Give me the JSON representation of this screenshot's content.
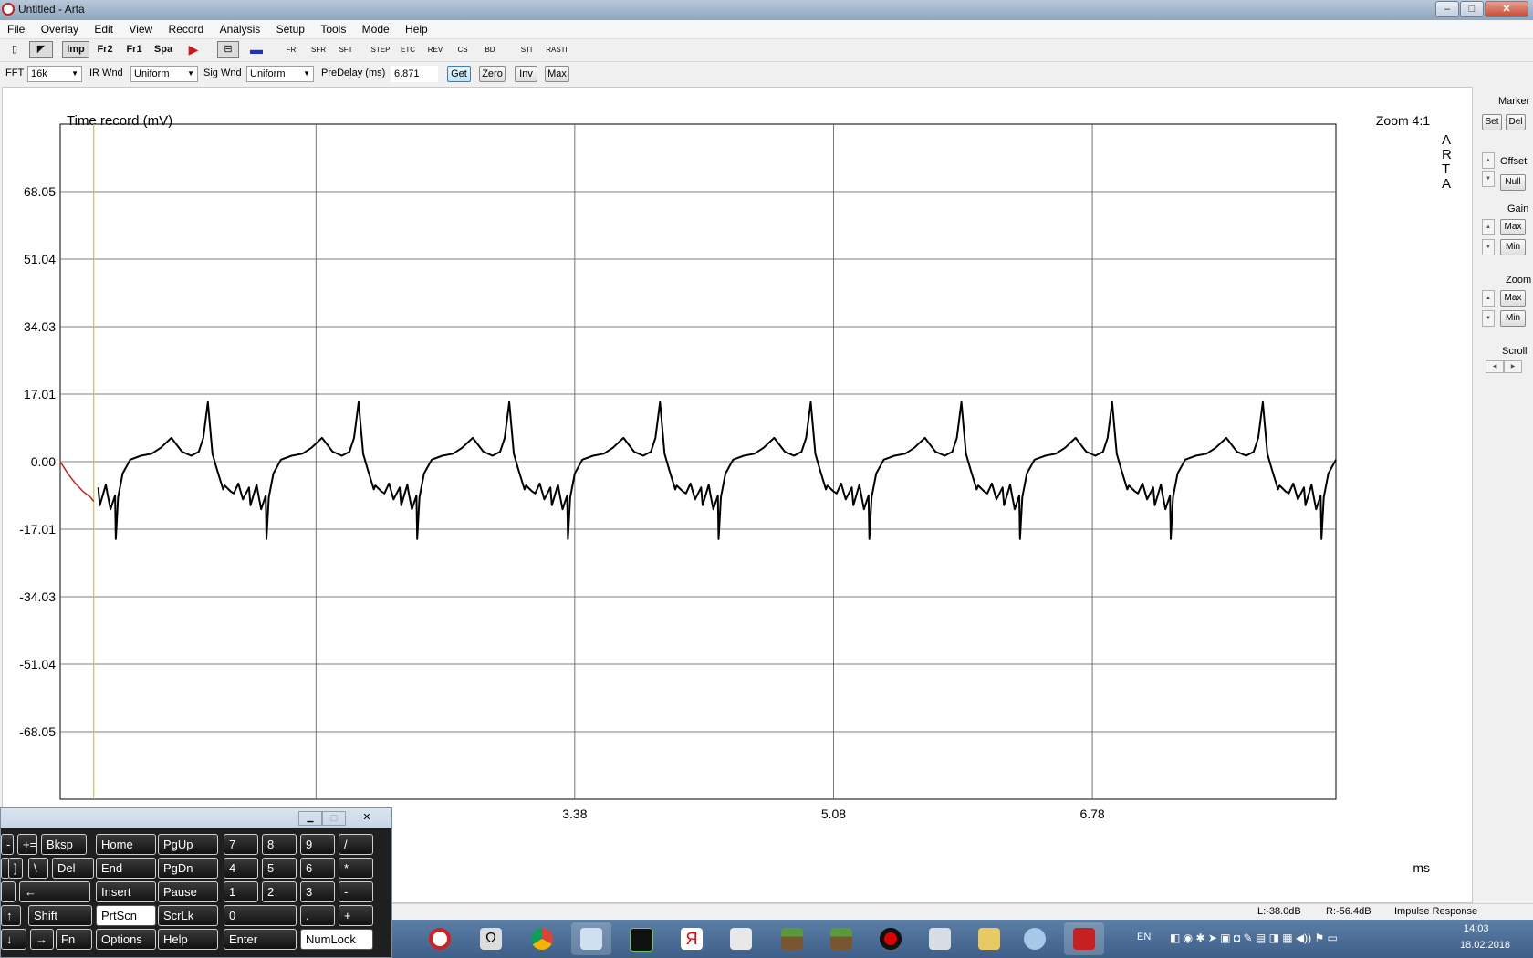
{
  "window": {
    "title": "Untitled - Arta",
    "buttons": {
      "min": "–",
      "max": "□",
      "close": "✕"
    }
  },
  "menu": [
    "File",
    "Overlay",
    "Edit",
    "View",
    "Record",
    "Analysis",
    "Setup",
    "Tools",
    "Mode",
    "Help"
  ],
  "toolbar": {
    "imp": "Imp",
    "fr2": "Fr2",
    "fr1": "Fr1",
    "spa": "Spa",
    "icons": [
      "FR",
      "SFR",
      "SFT",
      "STEP",
      "ETC",
      "REV",
      "CS",
      "BD",
      "STI",
      "RASTI"
    ]
  },
  "params": {
    "fft_label": "FFT",
    "fft_value": "16k",
    "ir_wnd_label": "IR Wnd",
    "ir_wnd_value": "Uniform",
    "sig_wnd_label": "Sig Wnd",
    "sig_wnd_value": "Uniform",
    "predelay_label": "PreDelay (ms)",
    "predelay_value": "6.871",
    "get": "Get",
    "zero": "Zero",
    "inv": "Inv",
    "max": "Max"
  },
  "side_panel": {
    "marker": "Marker",
    "set": "Set",
    "del": "Del",
    "offset": "Offset",
    "null": "Null",
    "gain": "Gain",
    "gain_max": "Max",
    "gain_min": "Min",
    "zoom": "Zoom",
    "zoom_max": "Max",
    "zoom_min": "Min",
    "scroll": "Scroll"
  },
  "chart_data": {
    "type": "line",
    "title": "Time record (mV)",
    "zoom_label": "Zoom 4:1",
    "watermark": [
      "A",
      "R",
      "T",
      "A"
    ],
    "xlabel": "ms",
    "xlim": [
      0.0,
      8.38
    ],
    "ylim": [
      -85.06,
      85.06
    ],
    "y_ticks": [
      "68.05",
      "51.04",
      "34.03",
      "17.01",
      "0.00",
      "-17.01",
      "-34.03",
      "-51.04",
      "-68.05"
    ],
    "y_tick_values": [
      68.05,
      51.04,
      34.03,
      17.01,
      0.0,
      -17.01,
      -34.03,
      -51.04,
      -68.05
    ],
    "x_ticks": [
      "3.38",
      "5.08",
      "6.78"
    ],
    "x_tick_values": [
      3.38,
      5.08,
      6.78
    ],
    "x_grid": [
      1.68,
      3.38,
      5.08,
      6.78
    ],
    "marker_x": 0.22,
    "pre_marker_color": "#cc2222",
    "trace_color": "#000000",
    "series": [
      {
        "period_ms": 0.99,
        "first_peak_ms": 0.97,
        "cycle_shape_mV": [
          [
            0.0,
            -7.0
          ],
          [
            0.05,
            -7.5
          ],
          [
            0.1,
            -5.5
          ],
          [
            0.17,
            -6.5
          ],
          [
            0.22,
            -5.8
          ],
          [
            0.25,
            -12.0
          ],
          [
            0.285,
            -19.5
          ],
          [
            0.3,
            -9.0
          ],
          [
            0.33,
            -3.0
          ],
          [
            0.38,
            0.5
          ],
          [
            0.45,
            1.5
          ],
          [
            0.52,
            2.0
          ],
          [
            0.58,
            3.5
          ],
          [
            0.65,
            6.0
          ],
          [
            0.72,
            2.5
          ],
          [
            0.78,
            1.5
          ],
          [
            0.83,
            2.5
          ],
          [
            0.86,
            6.0
          ],
          [
            0.89,
            15.0
          ],
          [
            0.92,
            2.0
          ],
          [
            0.95,
            -2.0
          ],
          [
            1.0,
            -6.0
          ],
          [
            1.06,
            -8.0
          ],
          [
            1.12,
            -9.5
          ],
          [
            1.17,
            -11.0
          ],
          [
            1.22,
            -8.0
          ],
          [
            1.27,
            -8.5
          ]
        ]
      }
    ]
  },
  "status": {
    "left_level": "L:-38.0dB",
    "right_level": "R:-56.4dB",
    "mode": "Impulse Response"
  },
  "osk": {
    "rows": [
      [
        "-",
        "+=",
        "Bksp",
        "Home",
        "PgUp",
        "7",
        "8",
        "9",
        "/"
      ],
      [
        "",
        "]",
        "\\",
        "Del",
        "End",
        "PgDn",
        "4",
        "5",
        "6",
        "*"
      ],
      [
        "",
        "←",
        "Insert",
        "Pause",
        "1",
        "2",
        "3",
        "-"
      ],
      [
        "↑",
        "Shift",
        "PrtScn",
        "ScrLk",
        "0",
        ".",
        "+"
      ],
      [
        "↓",
        "→",
        "Fn",
        "Options",
        "Help",
        "Enter",
        "NumLock"
      ]
    ]
  },
  "taskbar": {
    "lang": "EN",
    "time": "14:03",
    "date": "18.02.2018"
  }
}
